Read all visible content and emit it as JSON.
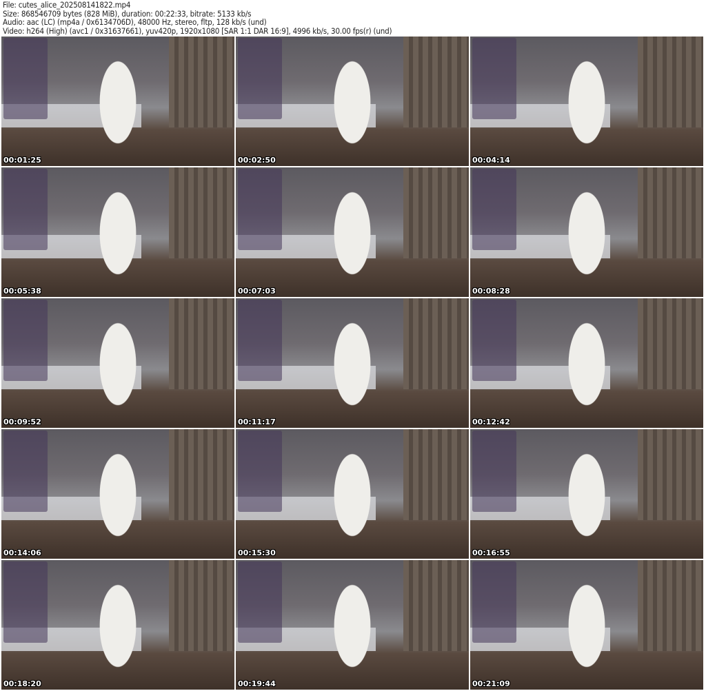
{
  "header": {
    "file": "File: cutes_alice_202508141822.mp4",
    "size": "Size: 868546709 bytes (828 MiB), duration: 00:22:33, bitrate: 5133 kb/s",
    "audio": "Audio: aac (LC) (mp4a / 0x6134706D), 48000 Hz, stereo, fltp, 128 kb/s (und)",
    "video": "Video: h264 (High) (avc1 / 0x31637661), yuv420p, 1920x1080 [SAR 1:1 DAR 16:9], 4996 kb/s, 30.00 fps(r) (und)"
  },
  "thumbnails": [
    {
      "timestamp": "00:01:25"
    },
    {
      "timestamp": "00:02:50"
    },
    {
      "timestamp": "00:04:14"
    },
    {
      "timestamp": "00:05:38"
    },
    {
      "timestamp": "00:07:03"
    },
    {
      "timestamp": "00:08:28"
    },
    {
      "timestamp": "00:09:52"
    },
    {
      "timestamp": "00:11:17"
    },
    {
      "timestamp": "00:12:42"
    },
    {
      "timestamp": "00:14:06"
    },
    {
      "timestamp": "00:15:30"
    },
    {
      "timestamp": "00:16:55"
    },
    {
      "timestamp": "00:18:20"
    },
    {
      "timestamp": "00:19:44"
    },
    {
      "timestamp": "00:21:09"
    }
  ]
}
